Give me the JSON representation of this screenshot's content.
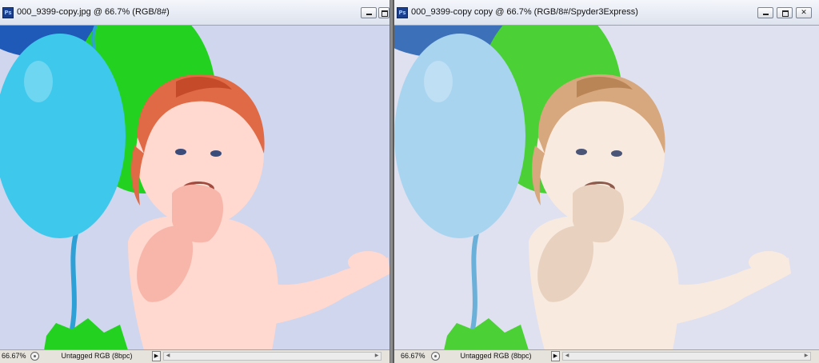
{
  "windows": [
    {
      "title": "000_9399-copy.jpg @ 66.7% (RGB/8#)",
      "app_icon": "photoshop-icon",
      "zoom": "66.67%",
      "doc_info": "Untagged RGB (8bpc)",
      "version": "oversaturated"
    },
    {
      "title": "000_9399-copy copy @ 66.7% (RGB/8#/Spyder3Express)",
      "app_icon": "photoshop-icon",
      "zoom": "66.67%",
      "doc_info": "Untagged RGB (8bpc)",
      "version": "corrected"
    }
  ],
  "buttons": {
    "minimize": "minimize-icon",
    "maximize": "maximize-icon",
    "close": "close-icon",
    "close_glyph": "✕",
    "status_arrow": "▶",
    "scroll_left": "◀",
    "scroll_right": "▶"
  },
  "icons": {
    "ps_glyph": "Ps"
  },
  "colors": {
    "left": {
      "bg": "#cfd6ee",
      "balloon_cyan": "#3ec8ec",
      "balloon_green": "#23d220",
      "balloon_blue": "#1f5ab8",
      "skin": "#ffd8cf",
      "skin_shadow": "#f7b6a9",
      "hair": "#e06a45",
      "hair_dark": "#c44a2a",
      "ribbon": "#2da0d6"
    },
    "right": {
      "bg": "#dfe1f0",
      "balloon_cyan": "#a9d4f0",
      "balloon_green": "#4bd035",
      "balloon_blue": "#3c70b8",
      "skin": "#f9eadf",
      "skin_shadow": "#e8d1bf",
      "hair": "#d7a77d",
      "hair_dark": "#b98456",
      "ribbon": "#6ab0d8"
    }
  }
}
